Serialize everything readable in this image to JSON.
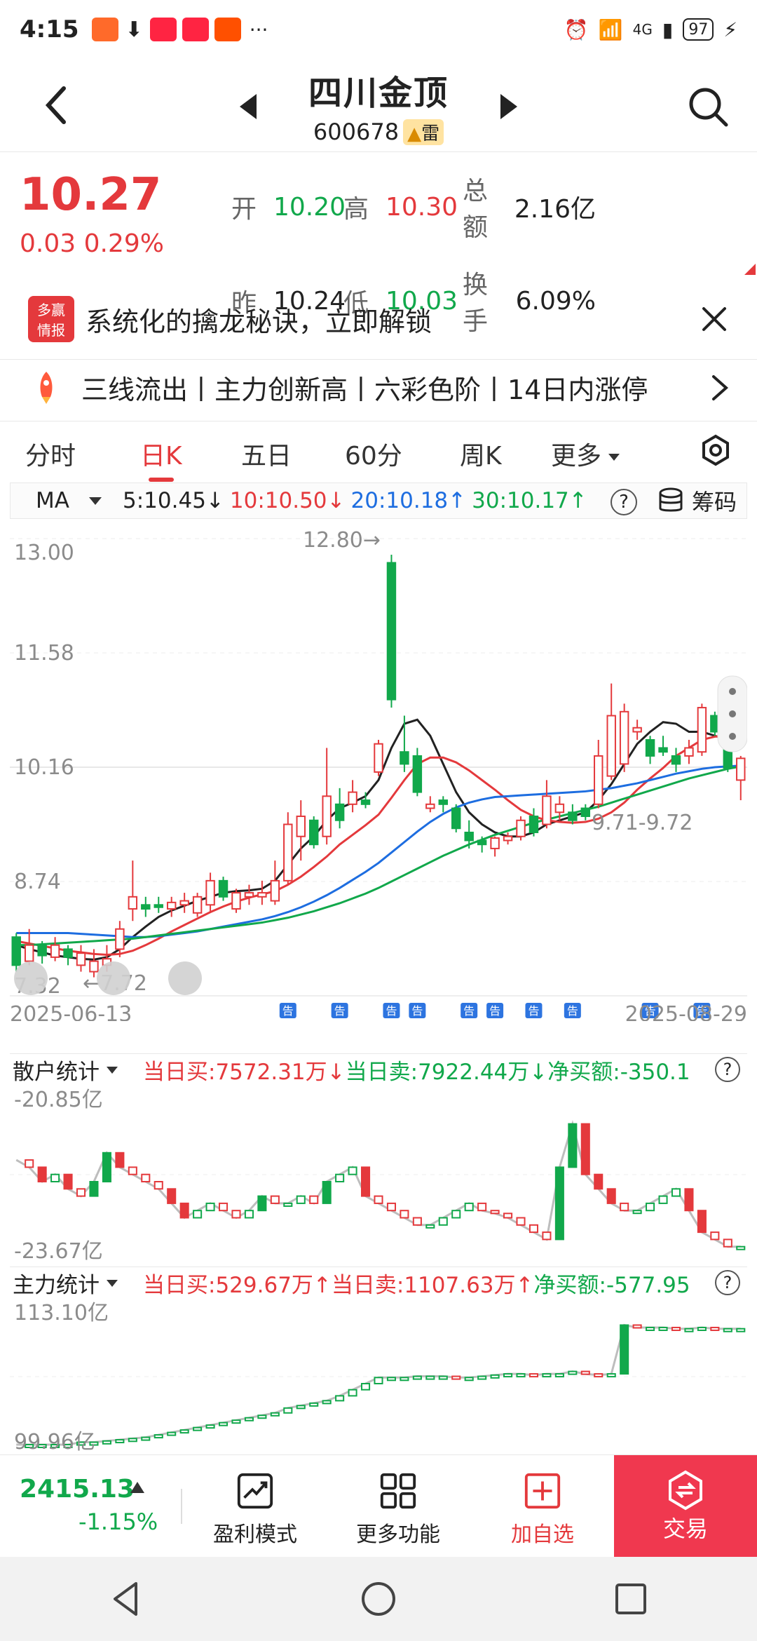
{
  "status": {
    "time": "4:15",
    "battery": "97",
    "network": "4G"
  },
  "header": {
    "title": "四川金顶",
    "code": "600678",
    "badge": "雷"
  },
  "quote": {
    "price": "10.27",
    "change": "0.03 0.29%",
    "open_label": "开",
    "open": "10.20",
    "high_label": "高",
    "high": "10.30",
    "amount_label": "总额",
    "amount": "2.16亿",
    "prev_label": "昨",
    "prev": "10.24",
    "low_label": "低",
    "low": "10.03",
    "turnover_label": "换手",
    "turnover": "6.09%"
  },
  "ad": {
    "logo_top": "多赢",
    "logo_bottom": "情报",
    "text": "系统化的擒龙秘诀，立即解锁"
  },
  "feature": {
    "text": "三线流出丨主力创新高丨六彩色阶丨14日内涨停"
  },
  "tabs": [
    "分时",
    "日K",
    "五日",
    "60分",
    "周K",
    "更多"
  ],
  "ma": {
    "selector": "MA",
    "ma5": "5:10.45↓",
    "ma10": "10:10.50↓",
    "ma20": "20:10.18↑",
    "ma30": "30:10.17↑",
    "chips": "筹码"
  },
  "chart_data": {
    "type": "candlestick",
    "y_ticks": [
      "13.00",
      "11.58",
      "10.16",
      "8.74",
      "7.32"
    ],
    "ylim": [
      7.32,
      13.0
    ],
    "x_start": "2025-06-13",
    "x_end": "2025-08-29",
    "annotations": [
      "12.80→",
      "←7.72",
      "9.71-9.72"
    ],
    "notice_marker": "告",
    "candles": [
      {
        "o": 7.7,
        "h": 8.1,
        "l": 7.62,
        "c": 8.05,
        "up": false
      },
      {
        "o": 7.95,
        "h": 8.15,
        "l": 7.7,
        "c": 7.75,
        "up": true
      },
      {
        "o": 7.82,
        "h": 8.0,
        "l": 7.72,
        "c": 7.95,
        "up": false
      },
      {
        "o": 7.95,
        "h": 8.05,
        "l": 7.75,
        "c": 7.8,
        "up": true
      },
      {
        "o": 7.8,
        "h": 7.95,
        "l": 7.7,
        "c": 7.9,
        "up": false
      },
      {
        "o": 7.85,
        "h": 7.95,
        "l": 7.62,
        "c": 7.7,
        "up": true
      },
      {
        "o": 7.75,
        "h": 7.9,
        "l": 7.55,
        "c": 7.62,
        "up": true
      },
      {
        "o": 7.78,
        "h": 7.95,
        "l": 7.62,
        "c": 7.7,
        "up": true
      },
      {
        "o": 7.9,
        "h": 8.25,
        "l": 7.8,
        "c": 8.15,
        "up": true
      },
      {
        "o": 8.4,
        "h": 9.0,
        "l": 8.25,
        "c": 8.55,
        "up": true
      },
      {
        "o": 8.45,
        "h": 8.55,
        "l": 8.3,
        "c": 8.4,
        "up": false
      },
      {
        "o": 8.45,
        "h": 8.55,
        "l": 8.35,
        "c": 8.42,
        "up": false
      },
      {
        "o": 8.4,
        "h": 8.55,
        "l": 8.3,
        "c": 8.48,
        "up": true
      },
      {
        "o": 8.45,
        "h": 8.6,
        "l": 8.35,
        "c": 8.5,
        "up": true
      },
      {
        "o": 8.35,
        "h": 8.6,
        "l": 8.3,
        "c": 8.55,
        "up": true
      },
      {
        "o": 8.45,
        "h": 8.85,
        "l": 8.35,
        "c": 8.75,
        "up": true
      },
      {
        "o": 8.75,
        "h": 8.8,
        "l": 8.5,
        "c": 8.55,
        "up": false
      },
      {
        "o": 8.4,
        "h": 8.65,
        "l": 8.35,
        "c": 8.6,
        "up": true
      },
      {
        "o": 8.6,
        "h": 8.7,
        "l": 8.45,
        "c": 8.55,
        "up": true
      },
      {
        "o": 8.55,
        "h": 8.75,
        "l": 8.45,
        "c": 8.6,
        "up": true
      },
      {
        "o": 8.5,
        "h": 9.0,
        "l": 8.45,
        "c": 8.75,
        "up": true
      },
      {
        "o": 8.75,
        "h": 9.6,
        "l": 8.7,
        "c": 9.45,
        "up": true
      },
      {
        "o": 9.3,
        "h": 9.75,
        "l": 9.0,
        "c": 9.55,
        "up": true
      },
      {
        "o": 9.5,
        "h": 9.55,
        "l": 9.15,
        "c": 9.2,
        "up": false
      },
      {
        "o": 9.3,
        "h": 10.4,
        "l": 9.2,
        "c": 9.8,
        "up": true
      },
      {
        "o": 9.5,
        "h": 9.9,
        "l": 9.4,
        "c": 9.7,
        "up": false
      },
      {
        "o": 9.7,
        "h": 10.0,
        "l": 9.6,
        "c": 9.85,
        "up": true
      },
      {
        "o": 9.75,
        "h": 9.85,
        "l": 9.65,
        "c": 9.7,
        "up": false
      },
      {
        "o": 10.1,
        "h": 10.5,
        "l": 10.05,
        "c": 10.45,
        "up": true
      },
      {
        "o": 11.0,
        "h": 12.8,
        "l": 10.9,
        "c": 12.7,
        "up": false
      },
      {
        "o": 10.2,
        "h": 10.8,
        "l": 10.1,
        "c": 10.35,
        "up": false
      },
      {
        "o": 10.3,
        "h": 10.4,
        "l": 9.8,
        "c": 9.85,
        "up": false
      },
      {
        "o": 9.7,
        "h": 9.8,
        "l": 9.6,
        "c": 9.65,
        "up": true
      },
      {
        "o": 9.75,
        "h": 9.8,
        "l": 9.6,
        "c": 9.7,
        "up": false
      },
      {
        "o": 9.65,
        "h": 9.7,
        "l": 9.35,
        "c": 9.4,
        "up": false
      },
      {
        "o": 9.35,
        "h": 9.5,
        "l": 9.15,
        "c": 9.25,
        "up": false
      },
      {
        "o": 9.2,
        "h": 9.3,
        "l": 9.1,
        "c": 9.25,
        "up": false
      },
      {
        "o": 9.15,
        "h": 9.3,
        "l": 9.05,
        "c": 9.28,
        "up": true
      },
      {
        "o": 9.25,
        "h": 9.35,
        "l": 9.2,
        "c": 9.3,
        "up": true
      },
      {
        "o": 9.3,
        "h": 9.55,
        "l": 9.25,
        "c": 9.5,
        "up": true
      },
      {
        "o": 9.55,
        "h": 9.65,
        "l": 9.3,
        "c": 9.35,
        "up": false
      },
      {
        "o": 9.45,
        "h": 10.0,
        "l": 9.4,
        "c": 9.8,
        "up": true
      },
      {
        "o": 9.7,
        "h": 9.8,
        "l": 9.5,
        "c": 9.6,
        "up": true
      },
      {
        "o": 9.6,
        "h": 9.7,
        "l": 9.45,
        "c": 9.5,
        "up": false
      },
      {
        "o": 9.55,
        "h": 9.7,
        "l": 9.5,
        "c": 9.65,
        "up": false
      },
      {
        "o": 9.7,
        "h": 10.5,
        "l": 9.65,
        "c": 10.3,
        "up": true
      },
      {
        "o": 10.05,
        "h": 11.2,
        "l": 10.0,
        "c": 10.8,
        "up": true
      },
      {
        "o": 10.2,
        "h": 10.95,
        "l": 10.1,
        "c": 10.85,
        "up": true
      },
      {
        "o": 10.6,
        "h": 10.75,
        "l": 10.5,
        "c": 10.65,
        "up": true
      },
      {
        "o": 10.5,
        "h": 10.55,
        "l": 10.2,
        "c": 10.3,
        "up": false
      },
      {
        "o": 10.4,
        "h": 10.55,
        "l": 10.3,
        "c": 10.35,
        "up": false
      },
      {
        "o": 10.3,
        "h": 10.4,
        "l": 10.1,
        "c": 10.2,
        "up": false
      },
      {
        "o": 10.3,
        "h": 10.5,
        "l": 10.2,
        "c": 10.4,
        "up": true
      },
      {
        "o": 10.35,
        "h": 10.95,
        "l": 10.3,
        "c": 10.9,
        "up": true
      },
      {
        "o": 10.8,
        "h": 10.85,
        "l": 10.55,
        "c": 10.6,
        "up": false
      },
      {
        "o": 10.55,
        "h": 10.6,
        "l": 10.1,
        "c": 10.15,
        "up": false
      },
      {
        "o": 10.0,
        "h": 10.3,
        "l": 9.75,
        "c": 10.27,
        "up": true
      }
    ],
    "series": [
      {
        "name": "MA5",
        "color": "#222222",
        "values": [
          7.95,
          7.9,
          7.86,
          7.82,
          7.8,
          7.78,
          7.77,
          7.8,
          7.9,
          8.05,
          8.18,
          8.3,
          8.38,
          8.44,
          8.5,
          8.55,
          8.6,
          8.62,
          8.63,
          8.65,
          8.75,
          8.95,
          9.15,
          9.3,
          9.5,
          9.65,
          9.72,
          9.8,
          10.0,
          10.4,
          10.7,
          10.75,
          10.55,
          10.2,
          9.85,
          9.6,
          9.45,
          9.35,
          9.3,
          9.3,
          9.35,
          9.45,
          9.5,
          9.55,
          9.6,
          9.75,
          9.95,
          10.2,
          10.45,
          10.6,
          10.72,
          10.7,
          10.6,
          10.6,
          10.55,
          10.5,
          10.45
        ]
      },
      {
        "name": "MA10",
        "color": "#e4393c",
        "values": [
          8.0,
          7.97,
          7.94,
          7.91,
          7.88,
          7.86,
          7.84,
          7.83,
          7.84,
          7.88,
          7.95,
          8.03,
          8.12,
          8.2,
          8.28,
          8.36,
          8.43,
          8.49,
          8.54,
          8.58,
          8.62,
          8.7,
          8.8,
          8.92,
          9.05,
          9.2,
          9.32,
          9.44,
          9.57,
          9.78,
          10.0,
          10.2,
          10.28,
          10.28,
          10.22,
          10.12,
          10.0,
          9.88,
          9.75,
          9.63,
          9.55,
          9.5,
          9.48,
          9.47,
          9.48,
          9.52,
          9.6,
          9.72,
          9.88,
          10.02,
          10.15,
          10.3,
          10.4,
          10.5,
          10.54,
          10.55,
          10.5
        ]
      },
      {
        "name": "MA20",
        "color": "#1d6de0",
        "values": [
          8.1,
          8.1,
          8.1,
          8.1,
          8.1,
          8.09,
          8.08,
          8.07,
          8.06,
          8.05,
          8.05,
          8.06,
          8.08,
          8.1,
          8.12,
          8.15,
          8.18,
          8.21,
          8.24,
          8.27,
          8.31,
          8.36,
          8.42,
          8.49,
          8.57,
          8.66,
          8.76,
          8.86,
          8.97,
          9.1,
          9.23,
          9.36,
          9.48,
          9.58,
          9.66,
          9.72,
          9.76,
          9.79,
          9.8,
          9.81,
          9.82,
          9.83,
          9.84,
          9.85,
          9.86,
          9.88,
          9.9,
          9.93,
          9.96,
          10.0,
          10.04,
          10.08,
          10.11,
          10.14,
          10.16,
          10.17,
          10.18
        ]
      },
      {
        "name": "MA30",
        "color": "#11a84b",
        "values": [
          7.95,
          7.95,
          7.96,
          7.97,
          7.98,
          7.99,
          8.0,
          8.01,
          8.02,
          8.03,
          8.05,
          8.07,
          8.09,
          8.11,
          8.13,
          8.15,
          8.17,
          8.19,
          8.21,
          8.23,
          8.26,
          8.29,
          8.33,
          8.37,
          8.42,
          8.47,
          8.53,
          8.59,
          8.66,
          8.74,
          8.82,
          8.9,
          8.98,
          9.06,
          9.13,
          9.2,
          9.26,
          9.32,
          9.37,
          9.42,
          9.47,
          9.51,
          9.55,
          9.59,
          9.63,
          9.67,
          9.72,
          9.77,
          9.82,
          9.87,
          9.92,
          9.97,
          10.02,
          10.06,
          10.1,
          10.14,
          10.17
        ]
      }
    ],
    "notice_positions": [
      21,
      25,
      29,
      31,
      35,
      37,
      40,
      43,
      49,
      53
    ]
  },
  "retail": {
    "title": "散户统计",
    "buy": "当日买:7572.31万↓",
    "sell": "当日卖:7922.44万↓",
    "net": "净买额:-350.1",
    "top": "-20.85亿",
    "bottom": "-23.67亿",
    "values": [
      0.65,
      0.6,
      0.5,
      0.55,
      0.45,
      0.4,
      0.5,
      0.7,
      0.6,
      0.55,
      0.5,
      0.45,
      0.35,
      0.25,
      0.3,
      0.35,
      0.3,
      0.25,
      0.3,
      0.4,
      0.35,
      0.35,
      0.4,
      0.35,
      0.5,
      0.55,
      0.6,
      0.4,
      0.35,
      0.3,
      0.25,
      0.2,
      0.2,
      0.25,
      0.3,
      0.35,
      0.3,
      0.28,
      0.25,
      0.2,
      0.15,
      0.1,
      0.6,
      0.9,
      0.55,
      0.45,
      0.35,
      0.3,
      0.3,
      0.35,
      0.4,
      0.45,
      0.3,
      0.15,
      0.1,
      0.05,
      0.05
    ]
  },
  "main": {
    "title": "主力统计",
    "buy": "当日买:529.67万↑",
    "sell": "当日卖:1107.63万↑",
    "net": "净买额:-577.95",
    "top": "113.10亿",
    "bottom": "99.96亿",
    "values": [
      0.0,
      0.0,
      0.0,
      0.0,
      0.0,
      0.02,
      0.02,
      0.03,
      0.04,
      0.05,
      0.06,
      0.08,
      0.1,
      0.12,
      0.14,
      0.16,
      0.18,
      0.2,
      0.22,
      0.24,
      0.26,
      0.3,
      0.32,
      0.34,
      0.36,
      0.4,
      0.45,
      0.5,
      0.55,
      0.55,
      0.55,
      0.56,
      0.56,
      0.56,
      0.55,
      0.55,
      0.56,
      0.57,
      0.58,
      0.58,
      0.57,
      0.58,
      0.58,
      0.6,
      0.58,
      0.57,
      0.58,
      0.98,
      0.96,
      0.96,
      0.96,
      0.95,
      0.95,
      0.96,
      0.95,
      0.95,
      0.95
    ]
  },
  "bottom": {
    "index": "2415.13",
    "index_change": "-1.15%",
    "item1": "盈利模式",
    "item2": "更多功能",
    "item3": "加自选",
    "trade": "交易"
  }
}
